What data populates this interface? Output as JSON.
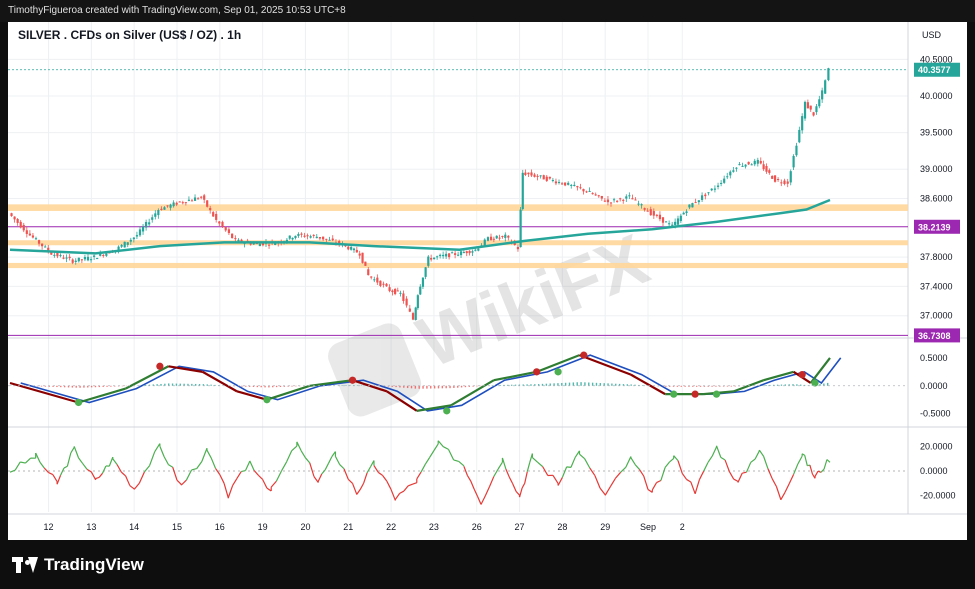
{
  "header": {
    "attribution": "TimothyFigueroa created with TradingView.com, Sep 01, 2025 10:53 UTC+8"
  },
  "brand": {
    "name": "TradingView",
    "icon": "tradingview-logo-icon"
  },
  "watermark": {
    "text": "WikiFX",
    "icon": "wikifx-logo-icon"
  },
  "colors": {
    "up_candle": "#26a69a",
    "down_candle": "#ef5350",
    "ema_line": "#26a69a",
    "zone_fill": "#ffd699",
    "level_line": "#9c27b0",
    "last_price_label": "#26a69a",
    "level_label": "#9c27b0",
    "macd_fast": "#2e7d32",
    "macd_slow": "#1e4fbf",
    "macd_signal_red": "#8b0000",
    "osc_up": "#4caf50",
    "osc_down": "#e53935"
  },
  "chart_data": [
    {
      "type": "candlestick",
      "title": "SILVER . CFDs on Silver (US$ / OZ) . 1h",
      "currency": "USD",
      "x_tick_labels": [
        "12",
        "13",
        "14",
        "15",
        "16",
        "19",
        "20",
        "21",
        "22",
        "23",
        "26",
        "27",
        "28",
        "29",
        "Sep",
        "2"
      ],
      "y_tick_labels": [
        "40.5000",
        "40.0000",
        "39.5000",
        "39.0000",
        "38.6000",
        "37.8000",
        "37.4000",
        "37.0000"
      ],
      "ylim": [
        36.75,
        40.6
      ],
      "last_price": 40.3577,
      "last_price_label": "40.3577",
      "horizontal_levels": [
        {
          "value": 38.2139,
          "label": "38.2139"
        },
        {
          "value": 36.7308,
          "label": "36.7308"
        }
      ],
      "support_resistance_zones": [
        {
          "from": 38.43,
          "to": 38.52
        },
        {
          "from": 37.97,
          "to": 38.03
        },
        {
          "from": 37.65,
          "to": 37.72
        }
      ],
      "close_series": [
        {
          "x": 0,
          "y": 38.4
        },
        {
          "x": 0.5,
          "y": 38.1
        },
        {
          "x": 1,
          "y": 37.85
        },
        {
          "x": 1.5,
          "y": 37.75
        },
        {
          "x": 2,
          "y": 37.8
        },
        {
          "x": 2.5,
          "y": 37.9
        },
        {
          "x": 3,
          "y": 38.1
        },
        {
          "x": 3.5,
          "y": 38.45
        },
        {
          "x": 4,
          "y": 38.55
        },
        {
          "x": 4.5,
          "y": 38.62
        },
        {
          "x": 4.85,
          "y": 38.3
        },
        {
          "x": 5.3,
          "y": 38.02
        },
        {
          "x": 5.8,
          "y": 37.98
        },
        {
          "x": 6.3,
          "y": 38.0
        },
        {
          "x": 6.7,
          "y": 38.1
        },
        {
          "x": 7.2,
          "y": 38.08
        },
        {
          "x": 7.8,
          "y": 37.97
        },
        {
          "x": 8.2,
          "y": 37.85
        },
        {
          "x": 8.4,
          "y": 37.55
        },
        {
          "x": 8.9,
          "y": 37.35
        },
        {
          "x": 9.15,
          "y": 37.3
        },
        {
          "x": 9.45,
          "y": 36.95
        },
        {
          "x": 9.55,
          "y": 37.3
        },
        {
          "x": 9.8,
          "y": 37.78
        },
        {
          "x": 10.5,
          "y": 37.85
        },
        {
          "x": 10.9,
          "y": 37.9
        },
        {
          "x": 11.2,
          "y": 38.05
        },
        {
          "x": 11.6,
          "y": 38.08
        },
        {
          "x": 11.9,
          "y": 37.92
        },
        {
          "x": 12.0,
          "y": 38.95
        },
        {
          "x": 12.5,
          "y": 38.88
        },
        {
          "x": 13,
          "y": 38.8
        },
        {
          "x": 13.5,
          "y": 38.7
        },
        {
          "x": 14,
          "y": 38.55
        },
        {
          "x": 14.5,
          "y": 38.62
        },
        {
          "x": 15,
          "y": 38.4
        },
        {
          "x": 15.5,
          "y": 38.22
        },
        {
          "x": 15.9,
          "y": 38.5
        },
        {
          "x": 16.5,
          "y": 38.75
        },
        {
          "x": 17,
          "y": 39.05
        },
        {
          "x": 17.5,
          "y": 39.1
        },
        {
          "x": 17.9,
          "y": 38.85
        },
        {
          "x": 18.2,
          "y": 38.82
        },
        {
          "x": 18.4,
          "y": 39.35
        },
        {
          "x": 18.6,
          "y": 39.9
        },
        {
          "x": 18.8,
          "y": 39.75
        },
        {
          "x": 19.0,
          "y": 40.05
        },
        {
          "x": 19.15,
          "y": 40.36
        }
      ],
      "ema_series": [
        {
          "x": 0,
          "y": 37.9
        },
        {
          "x": 2,
          "y": 37.85
        },
        {
          "x": 3.5,
          "y": 37.95
        },
        {
          "x": 5,
          "y": 38.0
        },
        {
          "x": 7,
          "y": 38.0
        },
        {
          "x": 8.5,
          "y": 37.95
        },
        {
          "x": 10.5,
          "y": 37.9
        },
        {
          "x": 12,
          "y": 38.02
        },
        {
          "x": 13.5,
          "y": 38.12
        },
        {
          "x": 15,
          "y": 38.18
        },
        {
          "x": 16.5,
          "y": 38.28
        },
        {
          "x": 18,
          "y": 38.4
        },
        {
          "x": 18.6,
          "y": 38.45
        },
        {
          "x": 19.15,
          "y": 38.58
        }
      ]
    },
    {
      "type": "line",
      "panel": "macd",
      "y_tick_labels": [
        "0.5000",
        "0.0000",
        "-0.5000"
      ],
      "ylim": [
        -0.65,
        0.75
      ],
      "series": [
        {
          "name": "",
          "points": [
            {
              "x": 0,
              "y": 0.05
            },
            {
              "x": 1.6,
              "y": -0.3
            },
            {
              "x": 2.7,
              "y": -0.05
            },
            {
              "x": 3.7,
              "y": 0.35
            },
            {
              "x": 4.5,
              "y": 0.25
            },
            {
              "x": 5.3,
              "y": -0.1
            },
            {
              "x": 6.0,
              "y": -0.25
            },
            {
              "x": 7,
              "y": 0.0
            },
            {
              "x": 8,
              "y": 0.1
            },
            {
              "x": 8.8,
              "y": -0.1
            },
            {
              "x": 9.5,
              "y": -0.45
            },
            {
              "x": 10.3,
              "y": -0.35
            },
            {
              "x": 11.3,
              "y": 0.1
            },
            {
              "x": 12.3,
              "y": 0.25
            },
            {
              "x": 13.3,
              "y": 0.55
            },
            {
              "x": 14.5,
              "y": 0.2
            },
            {
              "x": 15.3,
              "y": -0.15
            },
            {
              "x": 16.2,
              "y": -0.15
            },
            {
              "x": 16.9,
              "y": -0.1
            },
            {
              "x": 17.6,
              "y": 0.1
            },
            {
              "x": 18.3,
              "y": 0.25
            },
            {
              "x": 18.7,
              "y": 0.05
            },
            {
              "x": 19.15,
              "y": 0.5
            }
          ]
        }
      ],
      "markers": [
        {
          "x": 1.6,
          "y": -0.3,
          "kind": "bull"
        },
        {
          "x": 3.5,
          "y": 0.35,
          "kind": "bear"
        },
        {
          "x": 6.0,
          "y": -0.25,
          "kind": "bull"
        },
        {
          "x": 8.0,
          "y": 0.1,
          "kind": "bear"
        },
        {
          "x": 10.2,
          "y": -0.45,
          "kind": "bull"
        },
        {
          "x": 12.3,
          "y": 0.25,
          "kind": "bear"
        },
        {
          "x": 12.8,
          "y": 0.25,
          "kind": "bull"
        },
        {
          "x": 13.4,
          "y": 0.55,
          "kind": "bear"
        },
        {
          "x": 15.5,
          "y": -0.15,
          "kind": "bull"
        },
        {
          "x": 16.0,
          "y": -0.15,
          "kind": "bear"
        },
        {
          "x": 16.5,
          "y": -0.15,
          "kind": "bull"
        },
        {
          "x": 18.5,
          "y": 0.2,
          "kind": "bear"
        },
        {
          "x": 18.8,
          "y": 0.05,
          "kind": "bull"
        }
      ]
    },
    {
      "type": "line",
      "panel": "oscillator",
      "y_tick_labels": [
        "20.0000",
        "0.0000",
        "-20.0000"
      ],
      "ylim": [
        -32,
        32
      ],
      "series": [
        {
          "name": "",
          "points": [
            {
              "x": 0,
              "y": 0
            },
            {
              "x": 0.6,
              "y": 12
            },
            {
              "x": 1.1,
              "y": -10
            },
            {
              "x": 1.5,
              "y": 18
            },
            {
              "x": 2,
              "y": -8
            },
            {
              "x": 2.4,
              "y": 10
            },
            {
              "x": 2.9,
              "y": -14
            },
            {
              "x": 3.5,
              "y": 20
            },
            {
              "x": 4,
              "y": -12
            },
            {
              "x": 4.6,
              "y": 16
            },
            {
              "x": 5.1,
              "y": -20
            },
            {
              "x": 5.6,
              "y": 8
            },
            {
              "x": 6.1,
              "y": -16
            },
            {
              "x": 6.7,
              "y": 22
            },
            {
              "x": 7.2,
              "y": -8
            },
            {
              "x": 7.6,
              "y": 14
            },
            {
              "x": 8.1,
              "y": -18
            },
            {
              "x": 8.5,
              "y": 6
            },
            {
              "x": 9.0,
              "y": -22
            },
            {
              "x": 9.5,
              "y": -8
            },
            {
              "x": 10.0,
              "y": 22
            },
            {
              "x": 10.6,
              "y": 5
            },
            {
              "x": 11.0,
              "y": -25
            },
            {
              "x": 11.5,
              "y": 10
            },
            {
              "x": 11.9,
              "y": -20
            },
            {
              "x": 12.2,
              "y": 12
            },
            {
              "x": 12.8,
              "y": -10
            },
            {
              "x": 13.3,
              "y": 16
            },
            {
              "x": 13.9,
              "y": -20
            },
            {
              "x": 14.5,
              "y": 10
            },
            {
              "x": 15.0,
              "y": -18
            },
            {
              "x": 15.5,
              "y": 12
            },
            {
              "x": 16.0,
              "y": -16
            },
            {
              "x": 16.5,
              "y": 20
            },
            {
              "x": 17.0,
              "y": -10
            },
            {
              "x": 17.5,
              "y": 18
            },
            {
              "x": 18.0,
              "y": -22
            },
            {
              "x": 18.5,
              "y": 14
            },
            {
              "x": 18.8,
              "y": -5
            },
            {
              "x": 19.15,
              "y": 10
            }
          ]
        }
      ]
    }
  ]
}
